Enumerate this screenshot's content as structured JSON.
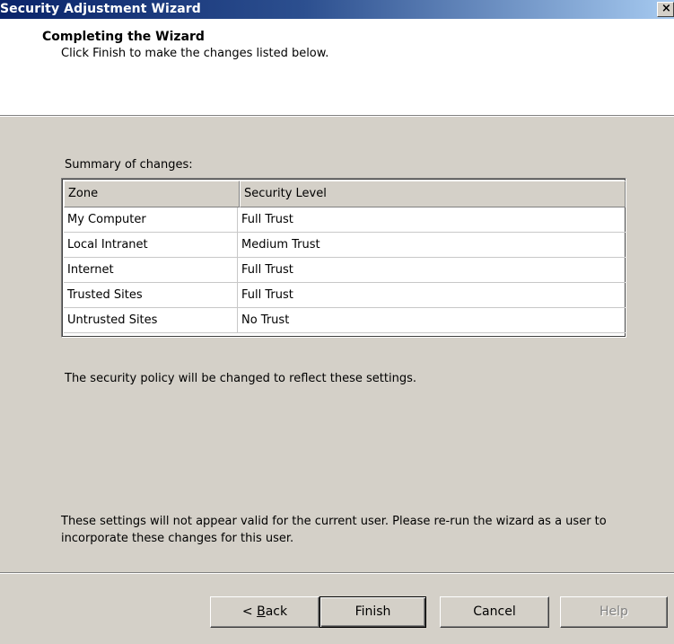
{
  "window": {
    "title": "Security Adjustment Wizard",
    "close_label": "×"
  },
  "header": {
    "title": "Completing the Wizard",
    "subtitle": "Click Finish to make the changes listed below."
  },
  "summary": {
    "label": "Summary of changes:",
    "columns": [
      "Zone",
      "Security Level"
    ],
    "rows": [
      {
        "zone": "My Computer",
        "level": "Full Trust"
      },
      {
        "zone": "Local Intranet",
        "level": "Medium Trust"
      },
      {
        "zone": "Internet",
        "level": "Full Trust"
      },
      {
        "zone": "Trusted Sites",
        "level": "Full Trust"
      },
      {
        "zone": "Untrusted Sites",
        "level": "No Trust"
      }
    ]
  },
  "info_text": "The security policy will be changed to reflect these settings.",
  "warning_text": "These settings will not appear valid for the current user. Please re-run the wizard as a user to incorporate these changes for this user.",
  "buttons": {
    "back_prefix": "< ",
    "back_mnemonic": "B",
    "back_rest": "ack",
    "finish": "Finish",
    "cancel": "Cancel",
    "help": "Help"
  },
  "colors": {
    "title_bar_start": "#0a246a",
    "title_bar_end": "#a6caf0",
    "dialog_face": "#d4d0c8",
    "header_background": "#ffffff"
  }
}
